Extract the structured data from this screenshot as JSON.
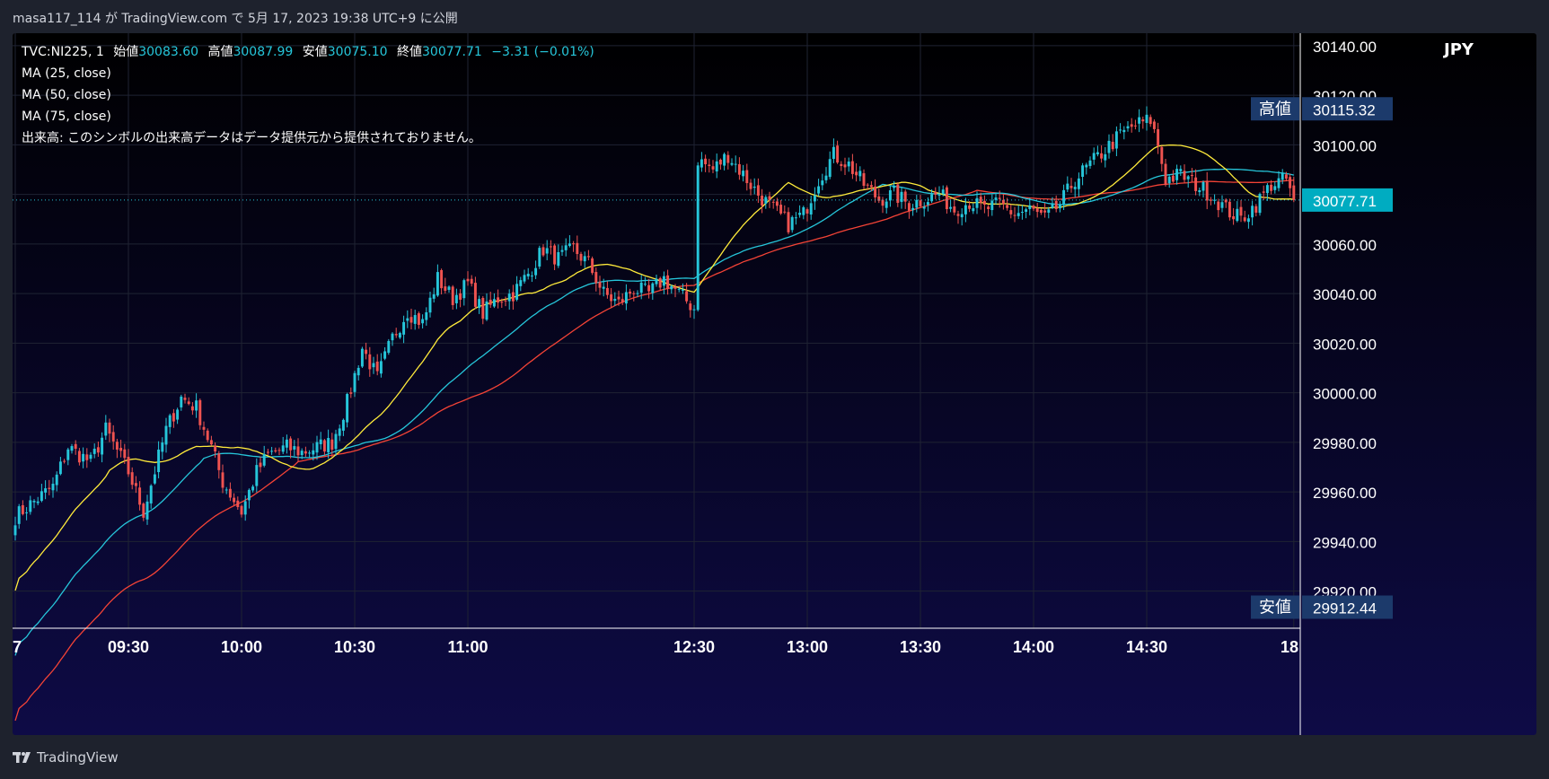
{
  "header": {
    "publish_line": "masa117_114 が TradingView.com で 5月 17, 2023 19:38 UTC+9 に公開"
  },
  "legend": {
    "symbol": "TVC:NI225, 1",
    "open_label": "始値",
    "open": "30083.60",
    "high_label": "高値",
    "high": "30087.99",
    "low_label": "安値",
    "low": "30075.10",
    "close_label": "終値",
    "close": "30077.71",
    "change": "−3.31 (−0.01%)",
    "ma1": "MA (25, close)",
    "ma2": "MA (50, close)",
    "ma3": "MA (75, close)",
    "volume_note": "出来高: このシンボルの出来高データはデータ提供元から提供されておりません。"
  },
  "price_axis": {
    "currency": "JPY",
    "high_tag_label": "高値",
    "high_tag_value": "30115.32",
    "low_tag_label": "安値",
    "low_tag_value": "29912.44",
    "last_value": "30077.71"
  },
  "footer": {
    "brand": "TradingView"
  },
  "colors": {
    "bull": "#26c6da",
    "bear": "#ef5350",
    "ma25": "#ffeb3b",
    "ma50": "#26c6da",
    "ma75": "#f44336",
    "bg_top": "#000000",
    "bg_bottom": "#0e0b46"
  },
  "chart_data": {
    "type": "candlestick",
    "symbol": "TVC:NI225",
    "interval": "1",
    "ylim": [
      29905,
      30145
    ],
    "y_ticks": [
      29920,
      29940,
      29960,
      29980,
      30000,
      30020,
      30040,
      30060,
      30080,
      30100,
      30120,
      30140
    ],
    "y_tick_labels": [
      "29920.00",
      "29940.00",
      "29960.00",
      "29980.00",
      "30000.00",
      "30020.00",
      "30040.00",
      "30060.00",
      "30080.00",
      "30100.00",
      "30120.00",
      "30140.00"
    ],
    "x_tick_labels": [
      "7",
      "09:30",
      "10:00",
      "10:30",
      "11:00",
      "12:30",
      "13:00",
      "13:30",
      "14:00",
      "14:30",
      "18"
    ],
    "close_path": [
      [
        0,
        29950
      ],
      [
        4,
        29955
      ],
      [
        10,
        29962
      ],
      [
        14,
        29978
      ],
      [
        20,
        29972
      ],
      [
        24,
        29985
      ],
      [
        30,
        29968
      ],
      [
        34,
        29952
      ],
      [
        40,
        29985
      ],
      [
        44,
        29998
      ],
      [
        48,
        29994
      ],
      [
        52,
        29978
      ],
      [
        55,
        29964
      ],
      [
        60,
        29952
      ],
      [
        64,
        29968
      ],
      [
        67,
        29975
      ],
      [
        72,
        29978
      ],
      [
        76,
        29976
      ],
      [
        80,
        29978
      ],
      [
        84,
        29980
      ],
      [
        88,
        29996
      ],
      [
        92,
        30018
      ],
      [
        96,
        30006
      ],
      [
        100,
        30022
      ],
      [
        104,
        30033
      ],
      [
        108,
        30028
      ],
      [
        112,
        30046
      ],
      [
        116,
        30038
      ],
      [
        120,
        30044
      ],
      [
        124,
        30032
      ],
      [
        128,
        30038
      ],
      [
        132,
        30040
      ],
      [
        136,
        30048
      ],
      [
        140,
        30058
      ],
      [
        144,
        30054
      ],
      [
        148,
        30058
      ],
      [
        152,
        30052
      ],
      [
        156,
        30040
      ],
      [
        160,
        30036
      ],
      [
        164,
        30042
      ],
      [
        168,
        30040
      ],
      [
        172,
        30046
      ],
      [
        176,
        30040
      ],
      [
        180,
        30034
      ],
      [
        181,
        30094
      ],
      [
        185,
        30090
      ],
      [
        189,
        30096
      ],
      [
        193,
        30088
      ],
      [
        197,
        30080
      ],
      [
        201,
        30074
      ],
      [
        205,
        30068
      ],
      [
        209,
        30072
      ],
      [
        213,
        30086
      ],
      [
        217,
        30096
      ],
      [
        221,
        30092
      ],
      [
        225,
        30084
      ],
      [
        229,
        30078
      ],
      [
        233,
        30080
      ],
      [
        237,
        30076
      ],
      [
        241,
        30078
      ],
      [
        245,
        30080
      ],
      [
        249,
        30074
      ],
      [
        253,
        30077
      ],
      [
        257,
        30074
      ],
      [
        261,
        30076
      ],
      [
        265,
        30072
      ],
      [
        269,
        30074
      ],
      [
        273,
        30070
      ],
      [
        277,
        30076
      ],
      [
        281,
        30086
      ],
      [
        285,
        30092
      ],
      [
        289,
        30098
      ],
      [
        293,
        30104
      ],
      [
        297,
        30108
      ],
      [
        301,
        30110
      ],
      [
        303,
        30100
      ],
      [
        305,
        30086
      ],
      [
        309,
        30088
      ],
      [
        313,
        30084
      ],
      [
        317,
        30080
      ],
      [
        321,
        30074
      ],
      [
        325,
        30070
      ],
      [
        329,
        30076
      ],
      [
        333,
        30084
      ],
      [
        337,
        30086
      ],
      [
        339,
        30077.71
      ]
    ]
  }
}
